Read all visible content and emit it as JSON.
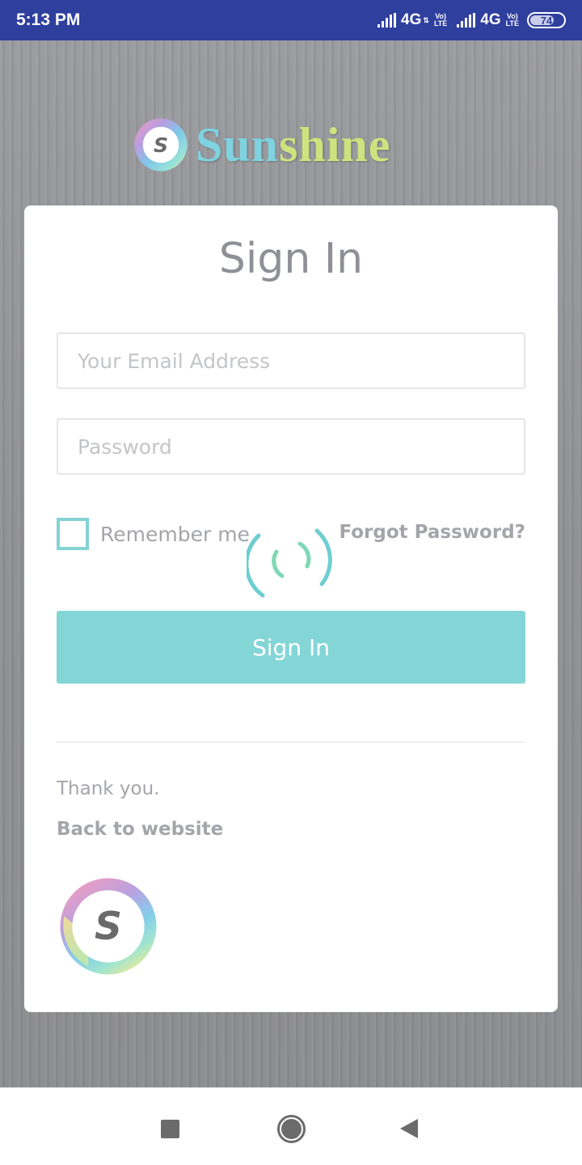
{
  "status_bar": {
    "time": "5:13 PM",
    "network_1": "4G",
    "network_2": "4G",
    "volte_top": "Vo)",
    "volte_bottom": "LTE",
    "battery_level": 74,
    "battery_label": "74"
  },
  "brand": {
    "name_part1": "Sun",
    "name_part2": "shine",
    "logo_letter": "S"
  },
  "login": {
    "title": "Sign In",
    "email_placeholder": "Your Email Address",
    "email_value": "",
    "password_placeholder": "Password",
    "password_value": "",
    "remember_label": "Remember me",
    "remember_checked": false,
    "forgot_label": "Forgot Password?",
    "submit_label": "Sign In",
    "loading": true
  },
  "footer": {
    "thanks": "Thank you.",
    "back_link": "Back to website"
  },
  "colors": {
    "accent": "#83d5d6",
    "status_bar": "#2f3f9e",
    "muted_text": "#a4a5ab"
  },
  "nav_bar": {
    "recents": "recents-icon",
    "home": "home-icon",
    "back": "back-icon"
  }
}
